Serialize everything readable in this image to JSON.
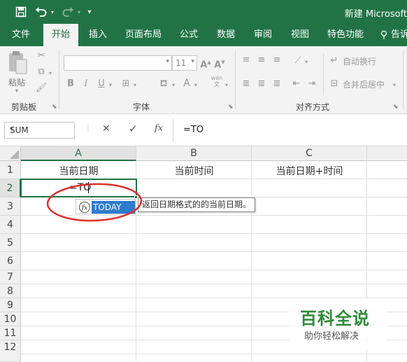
{
  "window": {
    "title": "新建 Microsoft"
  },
  "ribbon_tabs": [
    {
      "label": "文件"
    },
    {
      "label": "开始"
    },
    {
      "label": "插入"
    },
    {
      "label": "页面布局"
    },
    {
      "label": "公式"
    },
    {
      "label": "数据"
    },
    {
      "label": "审阅"
    },
    {
      "label": "视图"
    },
    {
      "label": "特色功能"
    },
    {
      "label": "告诉"
    }
  ],
  "clipboard": {
    "paste_label": "粘贴",
    "group_label": "剪贴板"
  },
  "font": {
    "name_value": "",
    "size_value": "11",
    "group_label": "字体",
    "bold": "B",
    "italic": "I",
    "underline": "U",
    "phonetic": "wén"
  },
  "alignment": {
    "wrap_text": "自动换行",
    "merge_center": "合并后居中",
    "group_label": "对齐方式"
  },
  "formula_bar": {
    "name_box": "SUM",
    "fx_label": "fx",
    "formula": "=TO"
  },
  "columns": [
    "A",
    "B",
    "C"
  ],
  "rows": [
    "1",
    "2",
    "3",
    "4",
    "5",
    "6",
    "7",
    "8",
    "9",
    "10",
    "11",
    "12"
  ],
  "cells": {
    "A1": "当前日期",
    "B1": "当前时间",
    "C1": "当前日期+时间",
    "A2": "=TO"
  },
  "autocomplete": {
    "item": "TODAY",
    "tooltip": "返回日期格式的的当前日期。"
  },
  "watermark": {
    "title": "百科全说",
    "subtitle": "助你轻松解决"
  },
  "colors": {
    "excel_green": "#217346",
    "annotation_red": "#d9302c",
    "selection_blue": "#2e7bcf"
  }
}
